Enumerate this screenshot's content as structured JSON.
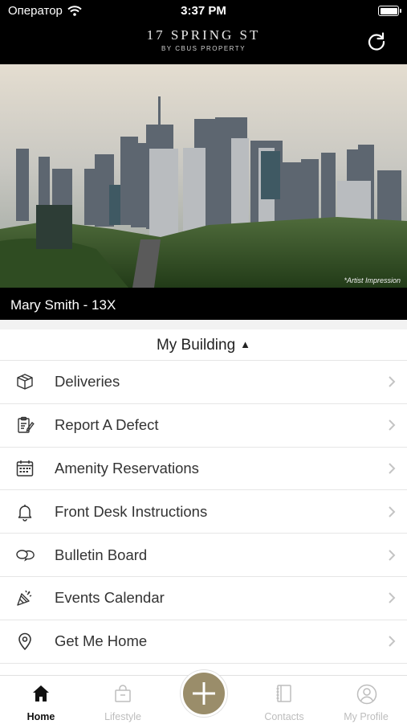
{
  "status_bar": {
    "carrier": "Оператор",
    "time": "3:37 PM"
  },
  "header": {
    "title": "17 SPRING ST",
    "subtitle": "BY CBUS PROPERTY"
  },
  "hero": {
    "caption": "*Artist Impression"
  },
  "resident": {
    "label": "Mary Smith - 13X"
  },
  "section": {
    "title": "My Building"
  },
  "menu": {
    "items": [
      {
        "label": "Deliveries",
        "icon": "package-icon"
      },
      {
        "label": "Report A Defect",
        "icon": "clipboard-pencil-icon"
      },
      {
        "label": "Amenity Reservations",
        "icon": "calendar-icon"
      },
      {
        "label": "Front Desk Instructions",
        "icon": "bell-icon"
      },
      {
        "label": "Bulletin Board",
        "icon": "chat-bubbles-icon"
      },
      {
        "label": "Events Calendar",
        "icon": "party-popper-icon"
      },
      {
        "label": "Get Me Home",
        "icon": "location-pin-icon"
      }
    ]
  },
  "tabs": [
    {
      "label": "Home",
      "icon": "home-icon",
      "active": true
    },
    {
      "label": "Lifestyle",
      "icon": "shopping-bag-icon",
      "active": false
    },
    {
      "label": "Contacts",
      "icon": "notebook-icon",
      "active": false
    },
    {
      "label": "My Profile",
      "icon": "user-circle-icon",
      "active": false
    }
  ],
  "colors": {
    "accent": "#9a8d6a",
    "bar_bg": "#000000"
  }
}
